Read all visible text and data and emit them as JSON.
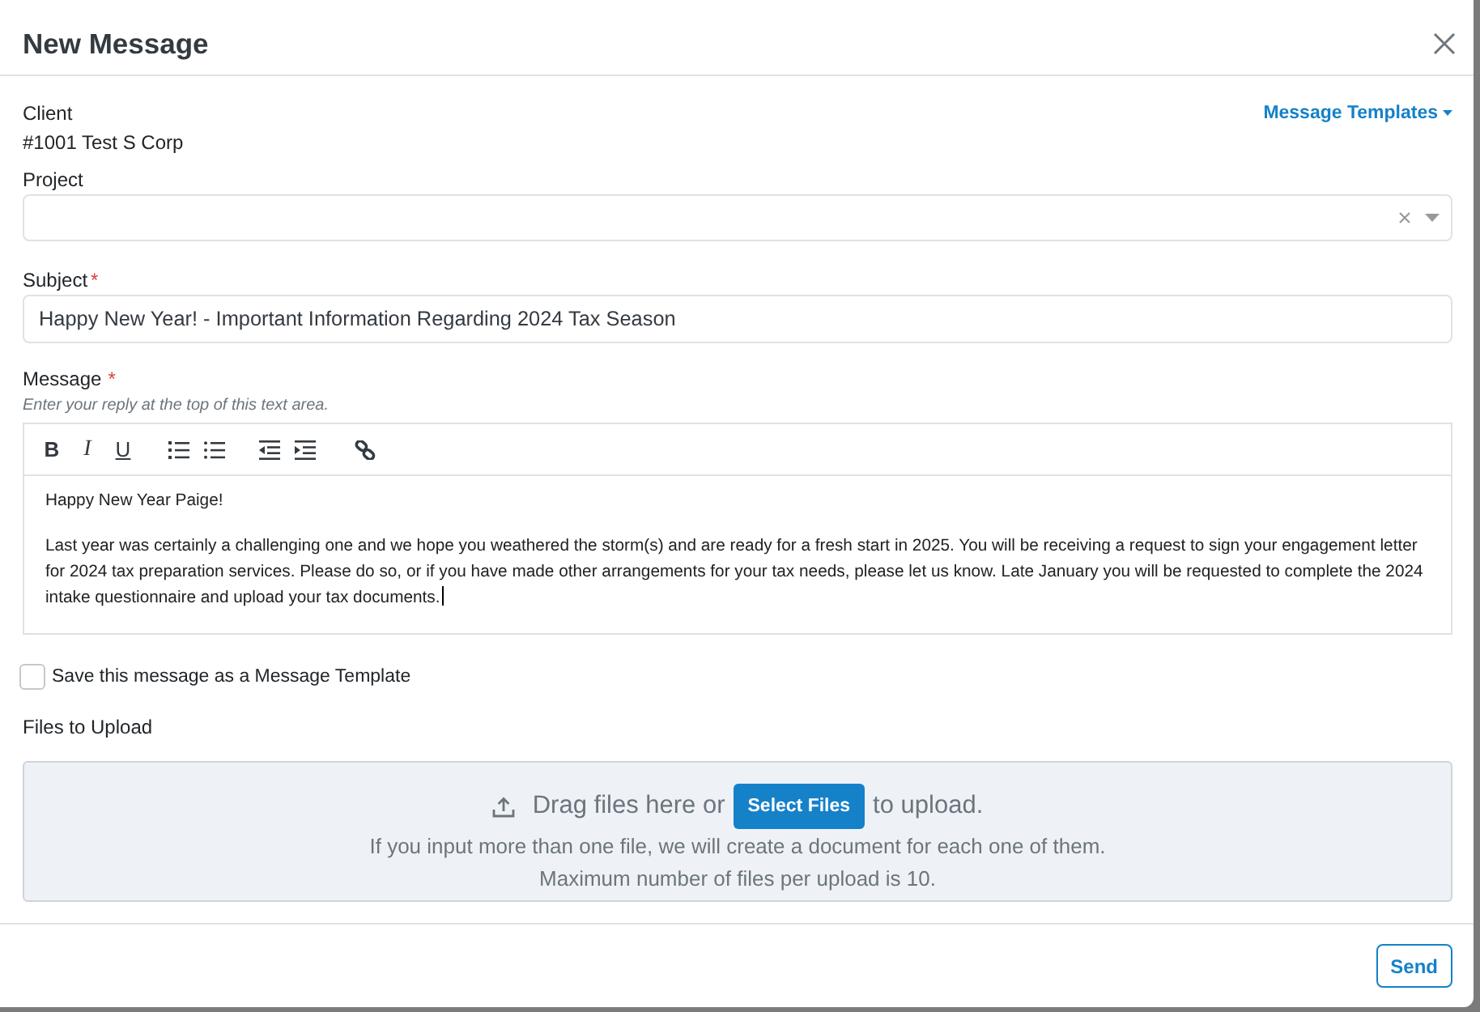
{
  "dialog": {
    "title": "New Message"
  },
  "client": {
    "label": "Client",
    "value": "#1001 Test S Corp"
  },
  "templates_menu": {
    "label": "Message Templates"
  },
  "project": {
    "label": "Project"
  },
  "subject": {
    "label": "Subject",
    "required_mark": "*",
    "value": "Happy New Year! - Important Information Regarding 2024 Tax Season"
  },
  "message": {
    "label": "Message",
    "required_mark": "*",
    "hint": "Enter your reply at the top of this text area.",
    "toolbar_groups": [
      {
        "items": [
          {
            "kind": "bold",
            "glyph": "B"
          },
          {
            "kind": "italic",
            "glyph": "I"
          },
          {
            "kind": "underline",
            "glyph": "U"
          }
        ]
      },
      {
        "items": [
          {
            "kind": "ordered-list"
          },
          {
            "kind": "bullet-list"
          }
        ]
      },
      {
        "items": [
          {
            "kind": "outdent"
          },
          {
            "kind": "indent"
          }
        ]
      },
      {
        "items": [
          {
            "kind": "link"
          }
        ]
      }
    ],
    "paragraphs": [
      "Happy New Year Paige!",
      "Last year was certainly a challenging one and we hope you weathered the storm(s) and are ready for a fresh start in 2025. You will be receiving a request to sign your engagement letter for 2024 tax preparation services. Please do so, or if you have made other arrangements for your tax needs, please let us know. Late January you will be requested to complete the 2024 intake questionnaire and upload your tax documents."
    ],
    "caret_at_end": true
  },
  "save_template": {
    "label": "Save this message as a Message Template",
    "checked": false
  },
  "upload": {
    "label": "Files to Upload",
    "prompt_before": "Drag files here or",
    "button": "Select Files",
    "prompt_after": "to upload.",
    "notes": [
      "If you input more than one file, we will create a document for each one of them.",
      "Maximum number of files per upload is 10."
    ]
  },
  "footer": {
    "send": "Send"
  }
}
